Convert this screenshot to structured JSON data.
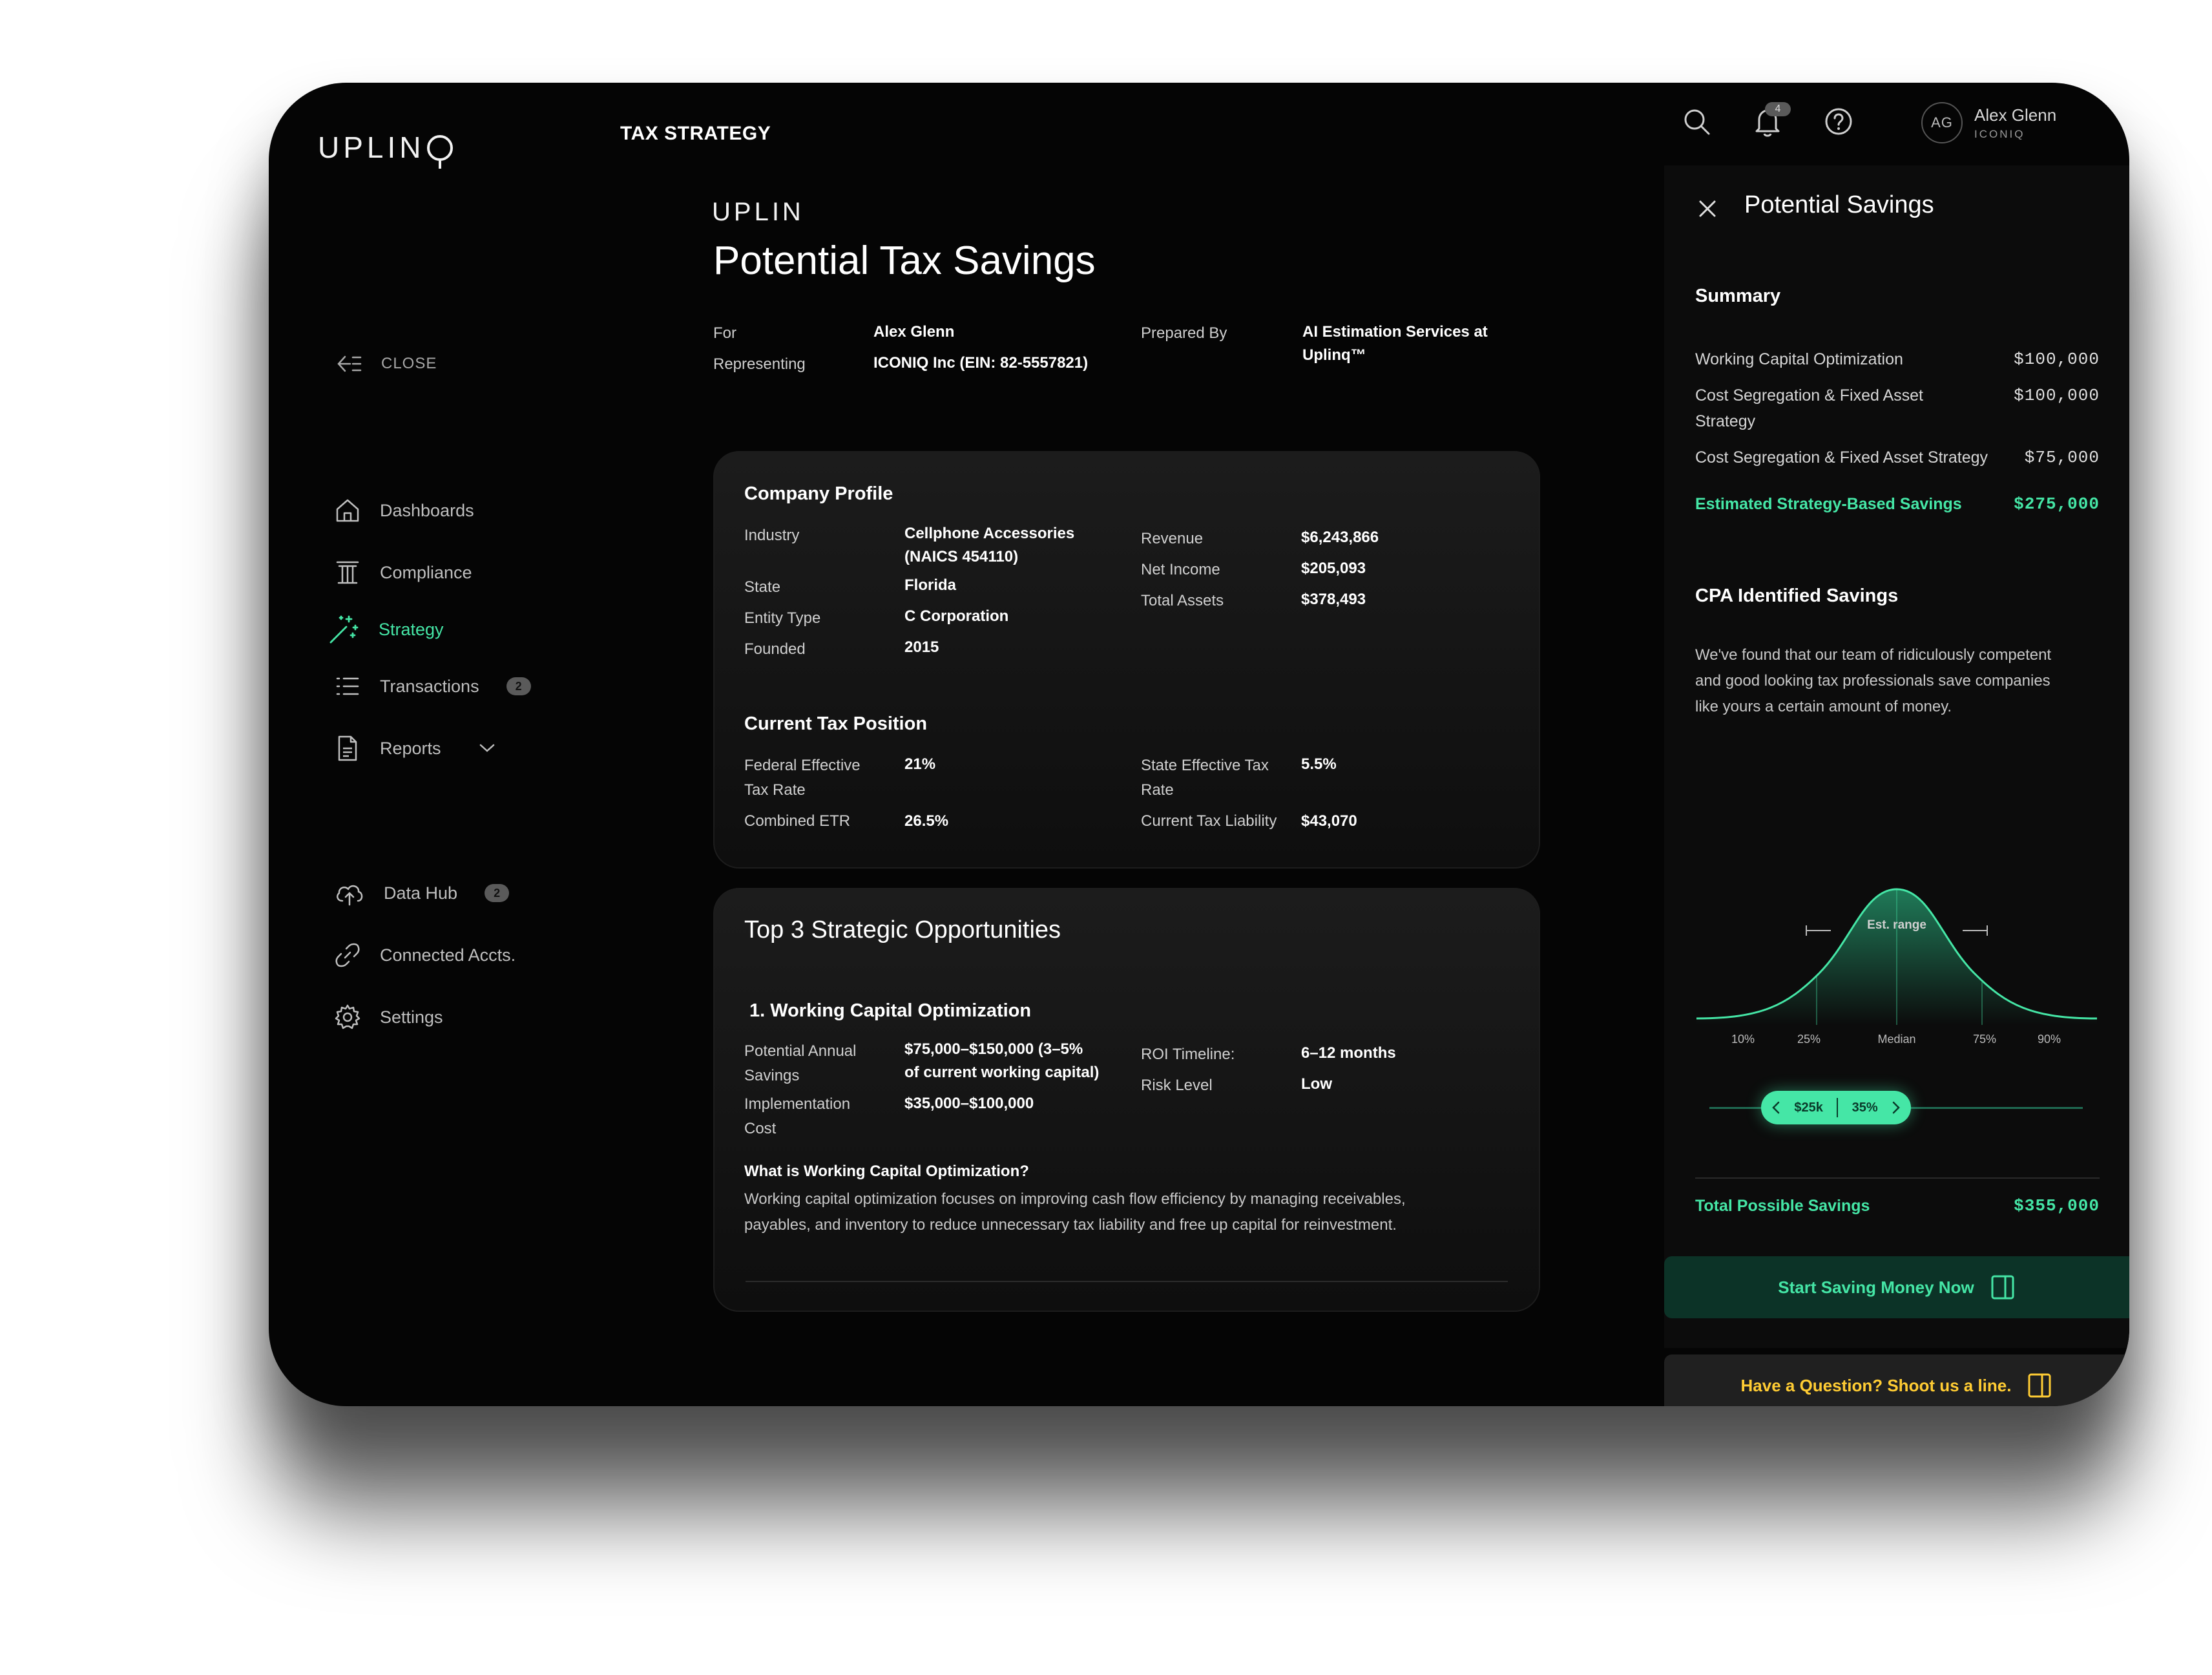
{
  "app": {
    "logo": "UPLIN",
    "page_title": "TAX STRATEGY"
  },
  "sidebar": {
    "close_label": "CLOSE",
    "items": [
      {
        "label": "Dashboards",
        "icon": "home-icon"
      },
      {
        "label": "Compliance",
        "icon": "pillar-icon"
      },
      {
        "label": "Strategy",
        "icon": "magic-wand-icon",
        "active": true
      },
      {
        "label": "Transactions",
        "icon": "list-icon",
        "badge": "2"
      },
      {
        "label": "Reports",
        "icon": "document-icon",
        "has_dropdown": true
      }
    ],
    "items_secondary": [
      {
        "label": "Data Hub",
        "icon": "cloud-upload-icon",
        "badge": "2"
      },
      {
        "label": "Connected Accts.",
        "icon": "link-icon"
      },
      {
        "label": "Settings",
        "icon": "gear-icon"
      }
    ]
  },
  "topbar": {
    "notification_count": "4",
    "user": {
      "initials": "AG",
      "name": "Alex Glenn",
      "org": "ICONIQ"
    }
  },
  "document": {
    "logo": "UPLIN",
    "title": "Potential Tax Savings",
    "for_label": "For",
    "for_value": "Alex Glenn",
    "representing_label": "Representing",
    "representing_value": "ICONIQ Inc (EIN: 82-5557821)",
    "prepared_by_label": "Prepared By",
    "prepared_by_value_line1": "AI Estimation Services at",
    "prepared_by_value_line2": "Uplinq™",
    "company_profile": {
      "heading": "Company Profile",
      "industry_label": "Industry",
      "industry_value_line1": "Cellphone Accessories",
      "industry_value_line2": "(NAICS 454110)",
      "state_label": "State",
      "state_value": "Florida",
      "entity_label": "Entity Type",
      "entity_value": "C Corporation",
      "founded_label": "Founded",
      "founded_value": "2015",
      "revenue_label": "Revenue",
      "revenue_value": "$6,243,866",
      "net_income_label": "Net Income",
      "net_income_value": "$205,093",
      "total_assets_label": "Total Assets",
      "total_assets_value": "$378,493"
    },
    "tax_position": {
      "heading": "Current Tax Position",
      "federal_label_line1": "Federal Effective",
      "federal_label_line2": "Tax Rate",
      "federal_value": "21%",
      "combined_label": "Combined ETR",
      "combined_value": "26.5%",
      "state_label_line1": "State Effective Tax",
      "state_label_line2": "Rate",
      "state_value": "5.5%",
      "liability_label": "Current Tax Liability",
      "liability_value": "$43,070"
    },
    "opportunities": {
      "heading": "Top 3 Strategic Opportunities",
      "item_title": "1. Working Capital Optimization",
      "savings_label_line1": "Potential Annual",
      "savings_label_line2": "Savings",
      "savings_value_line1": "$75,000–$150,000 (3–5%",
      "savings_value_line2": "of current working capital)",
      "impl_label_line1": "Implementation",
      "impl_label_line2": "Cost",
      "impl_value": "$35,000–$100,000",
      "roi_label": "ROI Timeline:",
      "roi_value": "6–12 months",
      "risk_label": "Risk Level",
      "risk_value": "Low",
      "what_heading": "What is Working Capital Optimization?",
      "what_text_line1": "Working capital optimization focuses on improving cash flow efficiency by managing receivables,",
      "what_text_line2": "payables, and inventory to reduce unnecessary tax liability and free up capital for reinvestment."
    }
  },
  "panel": {
    "title": "Potential Savings",
    "summary_heading": "Summary",
    "summary_rows": [
      {
        "label": "Working Capital Optimization",
        "amount": "$100,000"
      },
      {
        "label_line1": "Cost Segregation & Fixed Asset",
        "label_line2": "Strategy",
        "amount": "$100,000"
      },
      {
        "label": "Cost Segregation & Fixed Asset Strategy",
        "amount": "$75,000"
      }
    ],
    "estimated_label": "Estimated Strategy-Based Savings",
    "estimated_amount": "$275,000",
    "cpa_heading": "CPA Identified Savings",
    "cpa_text_line1": "We've found that our team of ridiculously competent",
    "cpa_text_line2": "and good looking tax professionals save companies",
    "cpa_text_line3": "like yours a certain amount of money.",
    "range_label": "Est. range",
    "ticks": [
      "10%",
      "25%",
      "Median",
      "75%",
      "90%"
    ],
    "slider_value": "$25k",
    "slider_percent": "35%",
    "total_label": "Total Possible Savings",
    "total_amount": "$355,000",
    "cta_primary": "Start Saving Money Now",
    "cta_secondary": "Have a Question? Shoot us a line.",
    "accent_color": "#45e6a6",
    "secondary_accent_color": "#ffcc33"
  }
}
